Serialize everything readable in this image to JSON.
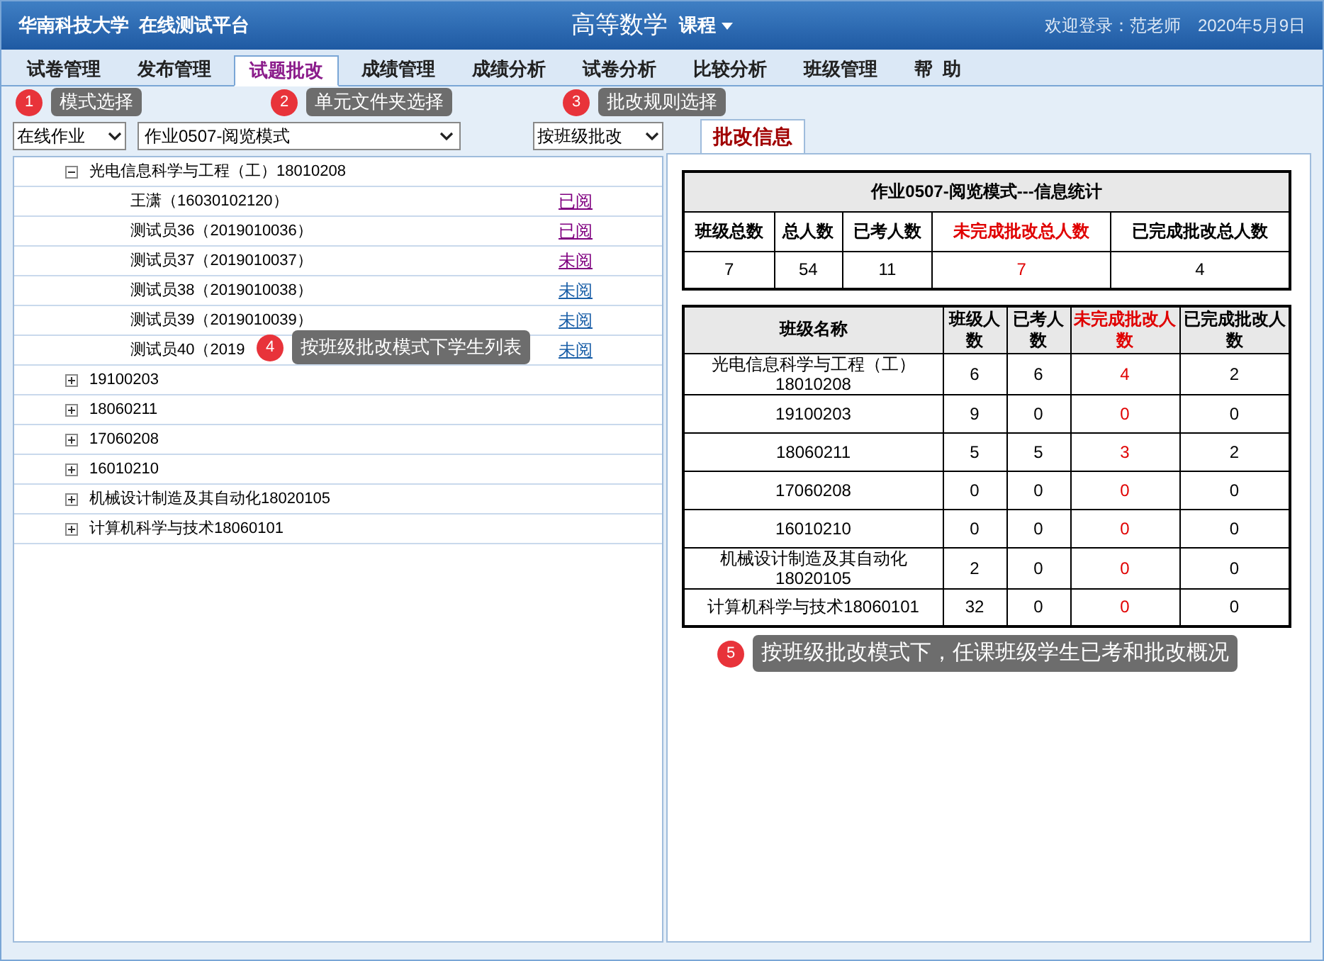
{
  "header": {
    "school": "华南科技大学  在线测试平台",
    "course": "高等数学",
    "course_menu": "课程",
    "welcome": "欢迎登录：范老师",
    "date": "2020年5月9日"
  },
  "tabs": [
    {
      "label": "试卷管理",
      "selected": false
    },
    {
      "label": "发布管理",
      "selected": false
    },
    {
      "label": "试题批改",
      "selected": true
    },
    {
      "label": "成绩管理",
      "selected": false
    },
    {
      "label": "成绩分析",
      "selected": false
    },
    {
      "label": "试卷分析",
      "selected": false
    },
    {
      "label": "比较分析",
      "selected": false
    },
    {
      "label": "班级管理",
      "selected": false
    },
    {
      "label": "帮  助",
      "selected": false
    }
  ],
  "filters": {
    "mode": "在线作业",
    "folder": "作业0507-阅览模式",
    "rule": "按班级批改"
  },
  "tree": [
    {
      "label": "光电信息科学与工程（工）18010208",
      "expanded": true,
      "children": [
        {
          "label": "王潇（16030102120）",
          "status": "已阅",
          "visited": true
        },
        {
          "label": "测试员36（2019010036）",
          "status": "已阅",
          "visited": true
        },
        {
          "label": "测试员37（2019010037）",
          "status": "未阅",
          "visited": true
        },
        {
          "label": "测试员38（2019010038）",
          "status": "未阅",
          "visited": false
        },
        {
          "label": "测试员39（2019010039）",
          "status": "未阅",
          "visited": false
        },
        {
          "label": "测试员40（2019",
          "status": "未阅",
          "visited": false
        }
      ]
    },
    {
      "label": "19100203",
      "expanded": false
    },
    {
      "label": "18060211",
      "expanded": false
    },
    {
      "label": "17060208",
      "expanded": false
    },
    {
      "label": "16010210",
      "expanded": false
    },
    {
      "label": "机械设计制造及其自动化18020105",
      "expanded": false
    },
    {
      "label": "计算机科学与技术18060101",
      "expanded": false
    }
  ],
  "panel_tab": "批改信息",
  "summary": {
    "title": "作业0507-阅览模式---信息统计",
    "columns": [
      "班级总数",
      "总人数",
      "已考人数",
      "未完成批改总人数",
      "已完成批改总人数"
    ],
    "values": [
      "7",
      "54",
      "11",
      "7",
      "4"
    ]
  },
  "class_table": {
    "columns": [
      "班级名称",
      "班级人数",
      "已考人数",
      "未完成批改人数",
      "已完成批改人数"
    ],
    "rows": [
      [
        "光电信息科学与工程（工）18010208",
        "6",
        "6",
        "4",
        "2"
      ],
      [
        "19100203",
        "9",
        "0",
        "0",
        "0"
      ],
      [
        "18060211",
        "5",
        "5",
        "3",
        "2"
      ],
      [
        "17060208",
        "0",
        "0",
        "0",
        "0"
      ],
      [
        "16010210",
        "0",
        "0",
        "0",
        "0"
      ],
      [
        "机械设计制造及其自动化18020105",
        "2",
        "0",
        "0",
        "0"
      ],
      [
        "计算机科学与技术18060101",
        "32",
        "0",
        "0",
        "0"
      ]
    ]
  },
  "callouts": [
    {
      "number": "1",
      "text": "模式选择"
    },
    {
      "number": "2",
      "text": "单元文件夹选择"
    },
    {
      "number": "3",
      "text": "批改规则选择"
    },
    {
      "number": "4",
      "text": "按班级批改模式下学生列表"
    },
    {
      "number": "5",
      "text": "按班级批改模式下，任课班级学生已考和批改概况"
    }
  ]
}
